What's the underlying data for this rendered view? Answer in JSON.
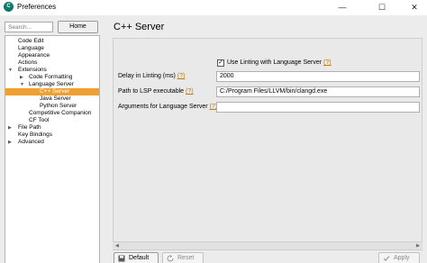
{
  "window": {
    "title": "Preferences",
    "minimize": "—",
    "maximize": "☐",
    "close": "✕"
  },
  "sidebar": {
    "search_placeholder": "Search...",
    "home_label": "Home",
    "tree": [
      "Code Edit",
      "Language",
      "Appearance",
      "Actions",
      "Extensions",
      "Code Formatting",
      "Language Server",
      "C++ Server",
      "Java Server",
      "Python Server",
      "Competitive Companion",
      "CF Tool",
      "File Path",
      "Key Bindings",
      "Advanced"
    ]
  },
  "main": {
    "title": "C++ Server",
    "use_linting": {
      "label": "Use Linting with Language Server",
      "help": "(?)",
      "checked": true
    },
    "delay": {
      "label": "Delay in Linting (ms)",
      "help": "(?)",
      "value": "2000"
    },
    "lsp_path": {
      "label": "Path to LSP executable",
      "help": "(?)",
      "value": "C:/Program Files/LLVM/bin/clangd.exe"
    },
    "args": {
      "label": "Arguments for Language Server",
      "help": "(?)",
      "value": ""
    }
  },
  "footer": {
    "default_label": "Default",
    "reset_label": "Reset",
    "apply_label": "Apply"
  }
}
